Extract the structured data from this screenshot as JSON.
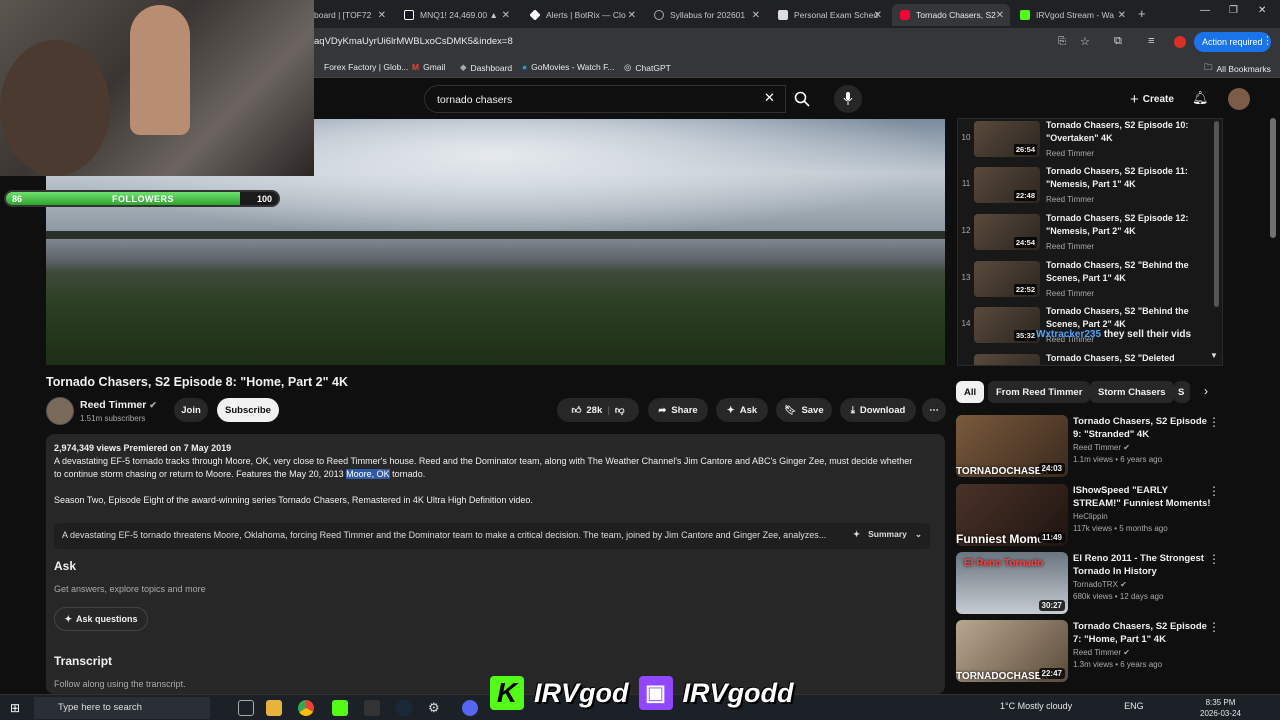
{
  "browser": {
    "tabs": [
      {
        "label": "board | [TOF72"
      },
      {
        "label": "MNQ1! 24,469.00 ▲"
      },
      {
        "label": "Alerts | BotRix — Clo"
      },
      {
        "label": "Syllabus for 202601"
      },
      {
        "label": "Personal Exam Sched"
      },
      {
        "label": "Tornado Chasers, S2"
      },
      {
        "label": "IRVgod Stream - Wa"
      }
    ],
    "url": "aqVDyKmaUyrUi6lrMWBLxoCsDMK5&index=8",
    "action_required": "Action required",
    "bookmarks": [
      "Forex Factory | Glob...",
      "Gmail",
      "Dashboard",
      "GoMovies - Watch F...",
      "ChatGPT"
    ],
    "all_bookmarks": "All Bookmarks"
  },
  "header": {
    "search_value": "tornado chasers",
    "create_label": "Create"
  },
  "overlay": {
    "followers_label": "FOLLOWERS",
    "followers_current": "86",
    "followers_goal": "100",
    "followers_progress": 0.86,
    "chat_user": "Wxtracker235",
    "chat_text": "they sell their vids"
  },
  "video": {
    "title": "Tornado Chasers, S2 Episode 8: \"Home, Part 2\" 4K",
    "channel": "Reed Timmer",
    "subscribers": "1.51m subscribers",
    "join_label": "Join",
    "subscribe_label": "Subscribe",
    "likes": "28k",
    "share_label": "Share",
    "ask_label": "Ask",
    "save_label": "Save",
    "download_label": "Download"
  },
  "description": {
    "stats": "2,974,349 views  Premiered on 7 May 2019",
    "line1": "A devastating EF-5 tornado tracks through Moore, OK, very close to Reed Timmer's house. Reed and the Dominator team, along with The Weather Channel's Jim Cantore and ABC's Ginger Zee, must decide whether",
    "line2a": "to continue storm chasing or return to Moore. Features the May 20, 2013 ",
    "line2_highlight": "Moore, OK",
    "line2b": " tornado.",
    "line3": "Season Two, Episode Eight of the award-winning series Tornado Chasers, Remastered in 4K Ultra High Definition video.",
    "summary_text": "A devastating EF-5 tornado threatens Moore, Oklahoma, forcing Reed Timmer and the Dominator team to make a critical decision. The team, joined by Jim Cantore and Ginger Zee, analyzes...",
    "summary_label": "Summary",
    "ask_heading": "Ask",
    "ask_sub": "Get answers, explore topics and more",
    "ask_button": "Ask questions",
    "transcript_heading": "Transcript",
    "transcript_sub": "Follow along using the transcript."
  },
  "playlist": [
    {
      "index": "10",
      "title": "Tornado Chasers, S2 Episode 10: \"Overtaken\" 4K",
      "channel": "Reed Timmer",
      "duration": "26:54"
    },
    {
      "index": "11",
      "title": "Tornado Chasers, S2 Episode 11: \"Nemesis, Part 1\" 4K",
      "channel": "Reed Timmer",
      "duration": "22:48"
    },
    {
      "index": "12",
      "title": "Tornado Chasers, S2 Episode 12: \"Nemesis, Part 2\" 4K",
      "channel": "Reed Timmer",
      "duration": "24:54"
    },
    {
      "index": "13",
      "title": "Tornado Chasers, S2 \"Behind the Scenes, Part 1\" 4K",
      "channel": "Reed Timmer",
      "duration": "22:52"
    },
    {
      "index": "14",
      "title": "Tornado Chasers, S2 \"Behind the Scenes, Part 2\" 4K",
      "channel": "Reed Timmer",
      "duration": "35:32"
    },
    {
      "index": "",
      "title": "Tornado Chasers, S2 \"Deleted",
      "channel": "",
      "duration": ""
    }
  ],
  "chips": [
    "All",
    "From Reed Timmer",
    "Storm Chasers",
    "S"
  ],
  "recommended": [
    {
      "title": "Tornado Chasers, S2 Episode 9: \"Stranded\" 4K",
      "channel": "Reed Timmer",
      "meta": "1.1m views • 6 years ago",
      "duration": "24:03",
      "thumb_text": "TORNADOCHASER"
    },
    {
      "title": "IShowSpeed \"EARLY STREAM!\" Funniest Moments!",
      "channel": "HeClippin",
      "meta": "117k views • 5 months ago",
      "duration": "11:49",
      "thumb_text": "Funniest Mome"
    },
    {
      "title": "El Reno 2011 - The Strongest Tornado In History",
      "channel": "TornadoTRX",
      "meta": "680k views • 12 days ago",
      "duration": "30:27",
      "thumb_text": "El Reno Tornado"
    },
    {
      "title": "Tornado Chasers, S2 Episode 7: \"Home, Part 1\" 4K",
      "channel": "Reed Timmer",
      "meta": "1.3m views • 6 years ago",
      "duration": "22:47",
      "thumb_text": "TORNADOCHASER"
    }
  ],
  "stream": {
    "kick_name": "IRVgod",
    "twitch_name": "IRVgodd"
  },
  "taskbar": {
    "search_placeholder": "Type here to search",
    "weather": "1°C  Mostly cloudy",
    "lang": "ENG",
    "time": "8:35 PM",
    "date": "2026-03-24"
  }
}
